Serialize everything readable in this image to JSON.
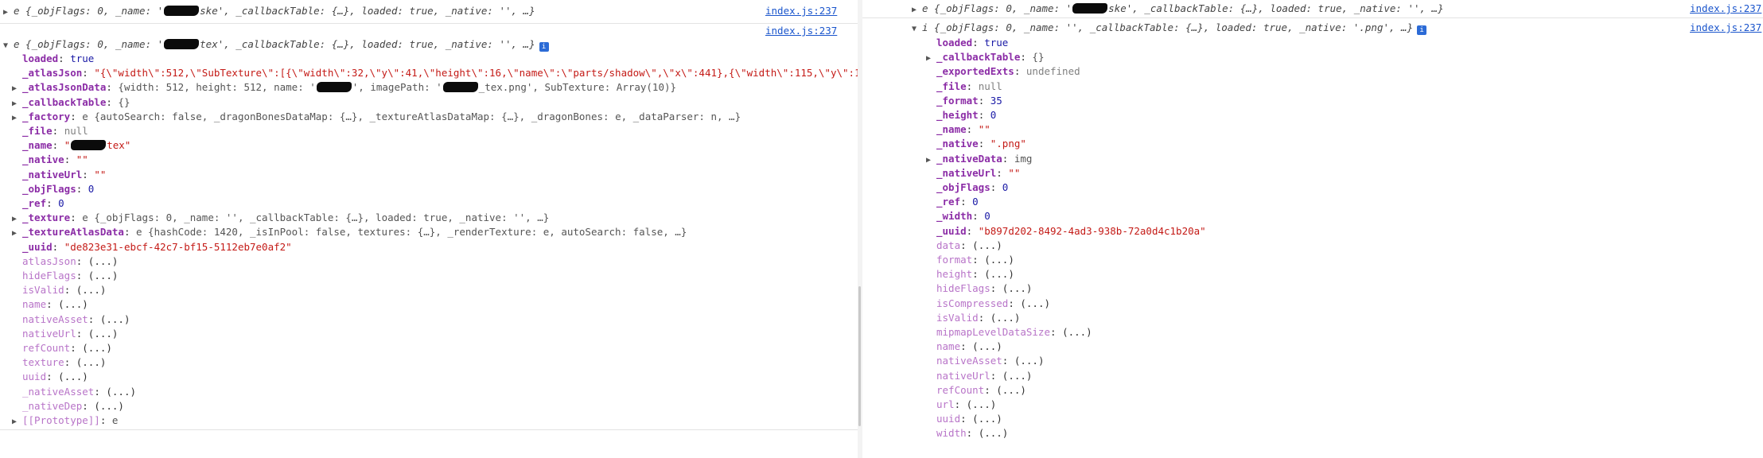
{
  "source_link": "index.js:237",
  "left": {
    "collapsed_summary": "e {_objFlags: 0, _name: '",
    "collapsed_summary_tail": "ske', _callbackTable: {…}, loaded: true, _native: '', …}",
    "expanded_summary": "e {_objFlags: 0, _name: '",
    "expanded_summary_tail": "tex', _callbackTable: {…}, loaded: true, _native: '', …}",
    "props": [
      {
        "key": "loaded",
        "type": "bool",
        "value": "true"
      },
      {
        "key": "_atlasJson",
        "type": "str",
        "value": "\"{\\\"width\\\":512,\\\"SubTexture\\\":[{\\\"width\\\":32,\\\"y\\\":41,\\\"height\\\":16,\\\"name\\\":\\\"parts/shadow\\\",\\\"x\\\":441},{\\\"width\\\":115,\\\"y\\\":173,\\\""
      },
      {
        "key": "_atlasJsonData",
        "type": "obj",
        "pre": "{width: 512, height: 512, name: '",
        "post": "', imagePath: '",
        "post2": "_tex.png', SubTexture: Array(10)}"
      },
      {
        "key": "_callbackTable",
        "type": "obj",
        "value": "{}"
      },
      {
        "key": "_factory",
        "type": "obj",
        "value": "e {autoSearch: false, _dragonBonesDataMap: {…}, _textureAtlasDataMap: {…}, _dragonBones: e, _dataParser: n, …}"
      },
      {
        "key": "_file",
        "type": "null",
        "value": "null"
      },
      {
        "key": "_name",
        "type": "redstr",
        "pre": "\"",
        "post": "tex\""
      },
      {
        "key": "_native",
        "type": "str",
        "value": "\"\""
      },
      {
        "key": "_nativeUrl",
        "type": "str",
        "value": "\"\""
      },
      {
        "key": "_objFlags",
        "type": "num",
        "value": "0"
      },
      {
        "key": "_ref",
        "type": "num",
        "value": "0"
      },
      {
        "key": "_texture",
        "type": "obj",
        "value": "e {_objFlags: 0, _name: '', _callbackTable: {…}, loaded: true, _native: '', …}"
      },
      {
        "key": "_textureAtlasData",
        "type": "obj",
        "value": "e {hashCode: 1420, _isInPool: false, textures: {…}, _renderTexture: e, autoSearch: false, …}"
      },
      {
        "key": "_uuid",
        "type": "str",
        "value": "\"de823e31-ebcf-42c7-bf15-5112eb7e0af2\""
      }
    ],
    "accessors": [
      "atlasJson",
      "hideFlags",
      "isValid",
      "name",
      "nativeAsset",
      "nativeUrl",
      "refCount",
      "texture",
      "uuid",
      "_nativeAsset",
      "_nativeDep"
    ],
    "prototype_label": "[[Prototype]]",
    "prototype_value": "e"
  },
  "right": {
    "collapsed_summary": "e {_objFlags: 0, _name: '",
    "collapsed_summary_tail": "ske', _callbackTable: {…}, loaded: true, _native: '', …}",
    "expanded_summary": "i {_objFlags: 0, _name: '', _callbackTable: {…}, loaded: true, _native: '.png', …}",
    "props": [
      {
        "key": "loaded",
        "type": "bool",
        "value": "true"
      },
      {
        "key": "_callbackTable",
        "type": "obj",
        "value": "{}"
      },
      {
        "key": "_exportedExts",
        "type": "null",
        "value": "undefined"
      },
      {
        "key": "_file",
        "type": "null",
        "value": "null"
      },
      {
        "key": "_format",
        "type": "num",
        "value": "35"
      },
      {
        "key": "_height",
        "type": "num",
        "value": "0"
      },
      {
        "key": "_name",
        "type": "str",
        "value": "\"\""
      },
      {
        "key": "_native",
        "type": "str",
        "value": "\".png\""
      },
      {
        "key": "_nativeData",
        "type": "obj",
        "value": "img"
      },
      {
        "key": "_nativeUrl",
        "type": "str",
        "value": "\"\""
      },
      {
        "key": "_objFlags",
        "type": "num",
        "value": "0"
      },
      {
        "key": "_ref",
        "type": "num",
        "value": "0"
      },
      {
        "key": "_width",
        "type": "num",
        "value": "0"
      },
      {
        "key": "_uuid",
        "type": "str",
        "value": "\"b897d202-8492-4ad3-938b-72a0d4c1b20a\""
      }
    ],
    "accessors": [
      "data",
      "format",
      "height",
      "hideFlags",
      "isCompressed",
      "isValid",
      "mipmapLevelDataSize",
      "name",
      "nativeAsset",
      "nativeUrl",
      "refCount",
      "url",
      "uuid",
      "width"
    ]
  },
  "ellipsis": "(...)",
  "icons": {
    "expand": "triangle-right-icon",
    "collapse": "triangle-down-icon",
    "info": "info-badge-icon"
  },
  "colors": {
    "key": "#8b2ca6",
    "string": "#c41a16",
    "number": "#1a1aa6",
    "link": "#1a55cc"
  }
}
